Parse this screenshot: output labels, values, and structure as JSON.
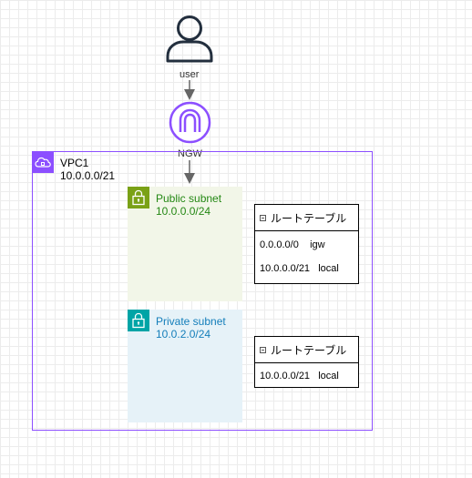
{
  "user": {
    "label": "user",
    "icon": "user-icon"
  },
  "gateway": {
    "label": "NGW",
    "icon": "nat-gateway-icon"
  },
  "vpc": {
    "name": "VPC1",
    "cidr": "10.0.0.0/21",
    "icon": "vpc-cloud-icon"
  },
  "public_subnet": {
    "name": "Public subnet",
    "cidr": "10.0.0.0/24",
    "icon": "lock-icon",
    "color": "#248814"
  },
  "private_subnet": {
    "name": "Private subnet",
    "cidr": "10.0.2.0/24",
    "icon": "lock-icon",
    "color": "#147eba"
  },
  "public_route_table": {
    "title": "ルートテーブル",
    "rows": [
      {
        "destination": "0.0.0.0/0",
        "target": "igw"
      },
      {
        "destination": "10.0.0.0/21",
        "target": "local"
      }
    ]
  },
  "private_route_table": {
    "title": "ルートテーブル",
    "rows": [
      {
        "destination": "10.0.0.0/21",
        "target": "local"
      }
    ]
  },
  "colors": {
    "vpc": "#8c4fff",
    "public": "#7aa116",
    "private": "#00a4a6",
    "arrow": "#666666"
  }
}
